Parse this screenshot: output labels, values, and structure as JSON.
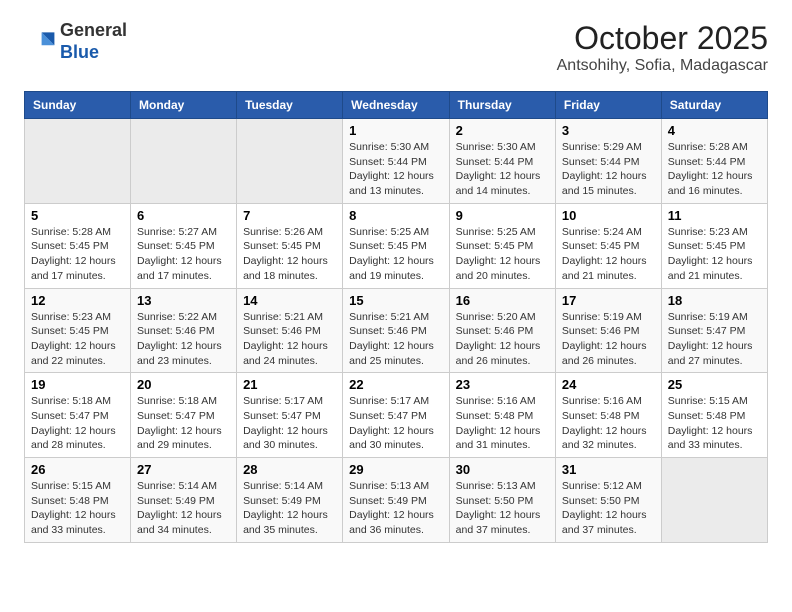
{
  "logo": {
    "general": "General",
    "blue": "Blue"
  },
  "header": {
    "month": "October 2025",
    "location": "Antsohihy, Sofia, Madagascar"
  },
  "weekdays": [
    "Sunday",
    "Monday",
    "Tuesday",
    "Wednesday",
    "Thursday",
    "Friday",
    "Saturday"
  ],
  "weeks": [
    [
      {
        "day": "",
        "info": ""
      },
      {
        "day": "",
        "info": ""
      },
      {
        "day": "",
        "info": ""
      },
      {
        "day": "1",
        "info": "Sunrise: 5:30 AM\nSunset: 5:44 PM\nDaylight: 12 hours\nand 13 minutes."
      },
      {
        "day": "2",
        "info": "Sunrise: 5:30 AM\nSunset: 5:44 PM\nDaylight: 12 hours\nand 14 minutes."
      },
      {
        "day": "3",
        "info": "Sunrise: 5:29 AM\nSunset: 5:44 PM\nDaylight: 12 hours\nand 15 minutes."
      },
      {
        "day": "4",
        "info": "Sunrise: 5:28 AM\nSunset: 5:44 PM\nDaylight: 12 hours\nand 16 minutes."
      }
    ],
    [
      {
        "day": "5",
        "info": "Sunrise: 5:28 AM\nSunset: 5:45 PM\nDaylight: 12 hours\nand 17 minutes."
      },
      {
        "day": "6",
        "info": "Sunrise: 5:27 AM\nSunset: 5:45 PM\nDaylight: 12 hours\nand 17 minutes."
      },
      {
        "day": "7",
        "info": "Sunrise: 5:26 AM\nSunset: 5:45 PM\nDaylight: 12 hours\nand 18 minutes."
      },
      {
        "day": "8",
        "info": "Sunrise: 5:25 AM\nSunset: 5:45 PM\nDaylight: 12 hours\nand 19 minutes."
      },
      {
        "day": "9",
        "info": "Sunrise: 5:25 AM\nSunset: 5:45 PM\nDaylight: 12 hours\nand 20 minutes."
      },
      {
        "day": "10",
        "info": "Sunrise: 5:24 AM\nSunset: 5:45 PM\nDaylight: 12 hours\nand 21 minutes."
      },
      {
        "day": "11",
        "info": "Sunrise: 5:23 AM\nSunset: 5:45 PM\nDaylight: 12 hours\nand 21 minutes."
      }
    ],
    [
      {
        "day": "12",
        "info": "Sunrise: 5:23 AM\nSunset: 5:45 PM\nDaylight: 12 hours\nand 22 minutes."
      },
      {
        "day": "13",
        "info": "Sunrise: 5:22 AM\nSunset: 5:46 PM\nDaylight: 12 hours\nand 23 minutes."
      },
      {
        "day": "14",
        "info": "Sunrise: 5:21 AM\nSunset: 5:46 PM\nDaylight: 12 hours\nand 24 minutes."
      },
      {
        "day": "15",
        "info": "Sunrise: 5:21 AM\nSunset: 5:46 PM\nDaylight: 12 hours\nand 25 minutes."
      },
      {
        "day": "16",
        "info": "Sunrise: 5:20 AM\nSunset: 5:46 PM\nDaylight: 12 hours\nand 26 minutes."
      },
      {
        "day": "17",
        "info": "Sunrise: 5:19 AM\nSunset: 5:46 PM\nDaylight: 12 hours\nand 26 minutes."
      },
      {
        "day": "18",
        "info": "Sunrise: 5:19 AM\nSunset: 5:47 PM\nDaylight: 12 hours\nand 27 minutes."
      }
    ],
    [
      {
        "day": "19",
        "info": "Sunrise: 5:18 AM\nSunset: 5:47 PM\nDaylight: 12 hours\nand 28 minutes."
      },
      {
        "day": "20",
        "info": "Sunrise: 5:18 AM\nSunset: 5:47 PM\nDaylight: 12 hours\nand 29 minutes."
      },
      {
        "day": "21",
        "info": "Sunrise: 5:17 AM\nSunset: 5:47 PM\nDaylight: 12 hours\nand 30 minutes."
      },
      {
        "day": "22",
        "info": "Sunrise: 5:17 AM\nSunset: 5:47 PM\nDaylight: 12 hours\nand 30 minutes."
      },
      {
        "day": "23",
        "info": "Sunrise: 5:16 AM\nSunset: 5:48 PM\nDaylight: 12 hours\nand 31 minutes."
      },
      {
        "day": "24",
        "info": "Sunrise: 5:16 AM\nSunset: 5:48 PM\nDaylight: 12 hours\nand 32 minutes."
      },
      {
        "day": "25",
        "info": "Sunrise: 5:15 AM\nSunset: 5:48 PM\nDaylight: 12 hours\nand 33 minutes."
      }
    ],
    [
      {
        "day": "26",
        "info": "Sunrise: 5:15 AM\nSunset: 5:48 PM\nDaylight: 12 hours\nand 33 minutes."
      },
      {
        "day": "27",
        "info": "Sunrise: 5:14 AM\nSunset: 5:49 PM\nDaylight: 12 hours\nand 34 minutes."
      },
      {
        "day": "28",
        "info": "Sunrise: 5:14 AM\nSunset: 5:49 PM\nDaylight: 12 hours\nand 35 minutes."
      },
      {
        "day": "29",
        "info": "Sunrise: 5:13 AM\nSunset: 5:49 PM\nDaylight: 12 hours\nand 36 minutes."
      },
      {
        "day": "30",
        "info": "Sunrise: 5:13 AM\nSunset: 5:50 PM\nDaylight: 12 hours\nand 37 minutes."
      },
      {
        "day": "31",
        "info": "Sunrise: 5:12 AM\nSunset: 5:50 PM\nDaylight: 12 hours\nand 37 minutes."
      },
      {
        "day": "",
        "info": ""
      }
    ]
  ]
}
